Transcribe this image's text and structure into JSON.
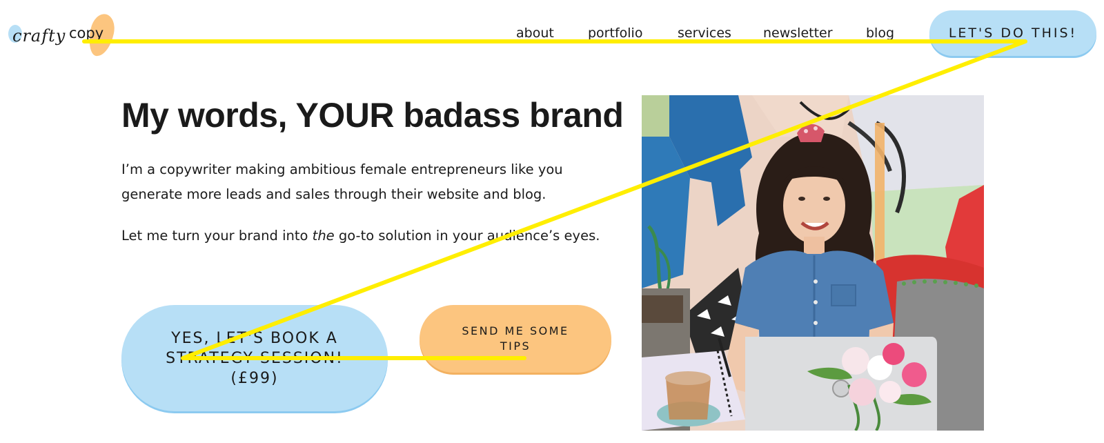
{
  "header": {
    "logo_script": "crafty",
    "logo_copy": "copy",
    "nav": [
      "about",
      "portfolio",
      "services",
      "newsletter",
      "blog"
    ],
    "cta": "LET'S DO THIS!"
  },
  "hero": {
    "title": "My words, YOUR badass brand",
    "paragraph1": "I’m a copywriter making ambitious female entrepreneurs like you generate more leads and sales through their website and blog.",
    "paragraph2_before": "Let me turn your brand into ",
    "paragraph2_emphasis": "the",
    "paragraph2_after": " go-to solution in your audience’s eyes.",
    "book_button": "YES, LET'S BOOK A STRATEGY SESSION! (£99)",
    "tips_button": "SEND ME SOME TIPS"
  },
  "colors": {
    "accent_blue": "#b7dff6",
    "accent_orange": "#fcc57f",
    "annotation_yellow": "#ffee00",
    "text": "#1a1a1a"
  }
}
